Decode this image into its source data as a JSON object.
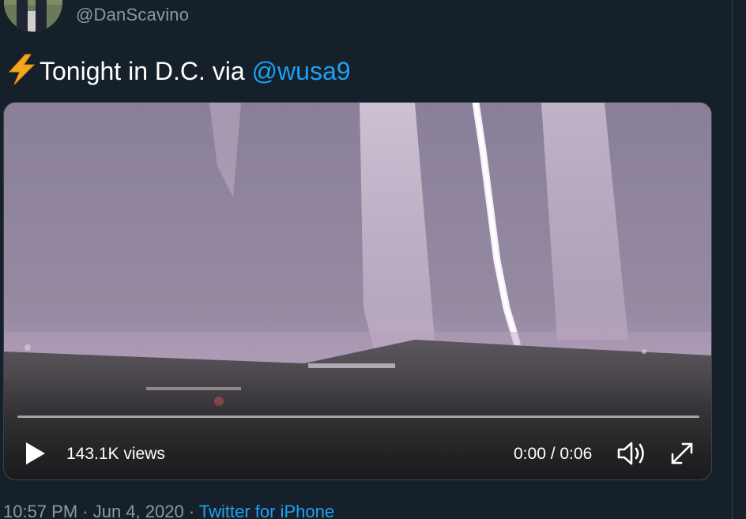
{
  "author": {
    "handle": "@DanScavino"
  },
  "tweet": {
    "emoji_icon": "lightning-bolt-icon",
    "text": "Tonight in D.C. via ",
    "mention": "@wusa9"
  },
  "video": {
    "views": "143.1K views",
    "time": "0:00 / 0:06",
    "progress": 0.0,
    "play_icon": "play-icon",
    "volume_icon": "volume-icon",
    "fullscreen_icon": "fullscreen-icon"
  },
  "meta": {
    "time": "10:57 PM",
    "separator_1": " · ",
    "date": "Jun 4, 2020",
    "separator_2": " · ",
    "source": "Twitter for iPhone"
  },
  "colors": {
    "background": "#15202b",
    "accent": "#1da1f2",
    "secondary_text": "#8899a6"
  }
}
